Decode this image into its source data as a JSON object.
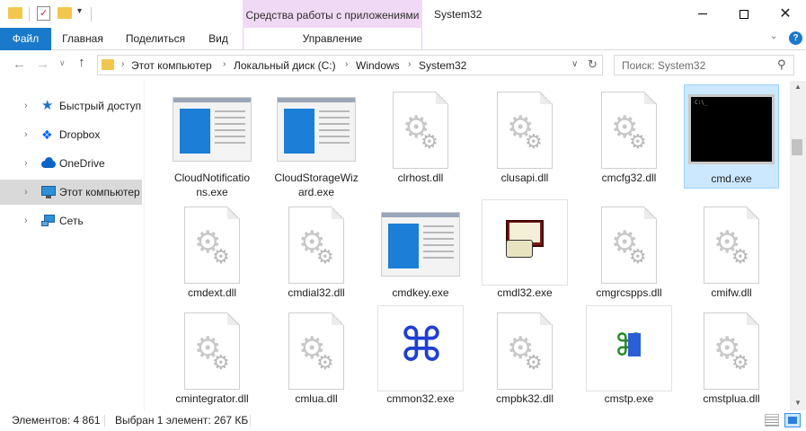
{
  "window": {
    "title": "System32",
    "context_tab_group": "Средства работы с приложениями",
    "context_tab": "Управление"
  },
  "ribbon": {
    "file_tab": "Файл",
    "tabs": [
      "Главная",
      "Поделиться",
      "Вид"
    ]
  },
  "address": {
    "crumbs": [
      "Этот компьютер",
      "Локальный диск (C:)",
      "Windows",
      "System32"
    ],
    "search_placeholder": "Поиск: System32"
  },
  "navpane": {
    "items": [
      {
        "label": "Быстрый доступ",
        "icon": "star-icon"
      },
      {
        "label": "Dropbox",
        "icon": "dropbox-icon"
      },
      {
        "label": "OneDrive",
        "icon": "cloud-icon"
      },
      {
        "label": "Этот компьютер",
        "icon": "computer-icon",
        "selected": true
      },
      {
        "label": "Сеть",
        "icon": "network-icon"
      }
    ]
  },
  "files": [
    {
      "name": "CloudNotifications.exe",
      "cap1": "CloudNotificatio",
      "cap2": "ns.exe",
      "kind": "window"
    },
    {
      "name": "CloudStorageWizard.exe",
      "cap1": "CloudStorageWiz",
      "cap2": "ard.exe",
      "kind": "window"
    },
    {
      "name": "clrhost.dll",
      "cap1": "clrhost.dll",
      "kind": "dll"
    },
    {
      "name": "clusapi.dll",
      "cap1": "clusapi.dll",
      "kind": "dll"
    },
    {
      "name": "cmcfg32.dll",
      "cap1": "cmcfg32.dll",
      "kind": "dll"
    },
    {
      "name": "cmd.exe",
      "cap1": "cmd.exe",
      "kind": "cmd",
      "selected": true
    },
    {
      "name": "cmdext.dll",
      "cap1": "cmdext.dll",
      "kind": "dll"
    },
    {
      "name": "cmdial32.dll",
      "cap1": "cmdial32.dll",
      "kind": "dll"
    },
    {
      "name": "cmdkey.exe",
      "cap1": "cmdkey.exe",
      "kind": "window"
    },
    {
      "name": "cmdl32.exe",
      "cap1": "cmdl32.exe",
      "kind": "phone"
    },
    {
      "name": "cmgrcspps.dll",
      "cap1": "cmgrcspps.dll",
      "kind": "dll"
    },
    {
      "name": "cmifw.dll",
      "cap1": "cmifw.dll",
      "kind": "dll"
    },
    {
      "name": "cmintegrator.dll",
      "cap1": "cmintegrator.dll",
      "kind": "dll"
    },
    {
      "name": "cmlua.dll",
      "cap1": "cmlua.dll",
      "kind": "dll"
    },
    {
      "name": "cmmon32.exe",
      "cap1": "cmmon32.exe",
      "kind": "cmd-symbol"
    },
    {
      "name": "cmpbk32.dll",
      "cap1": "cmpbk32.dll",
      "kind": "dll"
    },
    {
      "name": "cmstp.exe",
      "cap1": "cmstp.exe",
      "kind": "cmstp"
    },
    {
      "name": "cmstplua.dll",
      "cap1": "cmstplua.dll",
      "kind": "dll"
    }
  ],
  "status": {
    "count": "Элементов: 4 861",
    "selection": "Выбран 1 элемент: 267 КБ"
  }
}
